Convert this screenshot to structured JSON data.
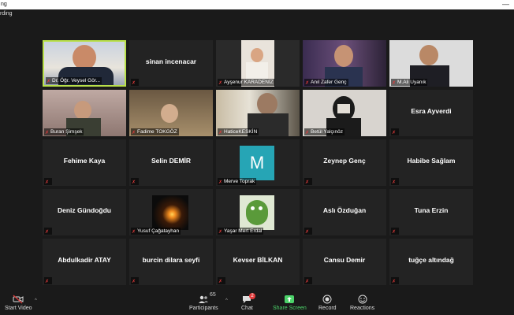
{
  "window": {
    "title": "ng",
    "minimize_glyph": "—"
  },
  "recording_label": "rding",
  "tiles": [
    {
      "name": "Dr. Öğr. Veysel Gör...",
      "kind": "video"
    },
    {
      "name": "sinan incenacar",
      "kind": "name"
    },
    {
      "name": "Ayşenur KARADENİZ",
      "kind": "video"
    },
    {
      "name": "Anıl Zafer Genç",
      "kind": "video"
    },
    {
      "name": "M.Ali Uyanık",
      "kind": "video"
    },
    {
      "name": "Buran Şimşek",
      "kind": "video"
    },
    {
      "name": "Fadime TOKGÖZ",
      "kind": "video"
    },
    {
      "name": "HaticeKESKİN",
      "kind": "video"
    },
    {
      "name": "Betül Yalçınöz",
      "kind": "video"
    },
    {
      "name": "Esra Ayverdi",
      "kind": "name"
    },
    {
      "name": "Fehime Kaya",
      "kind": "name"
    },
    {
      "name": "Selin DEMİR",
      "kind": "name"
    },
    {
      "name": "Merve Toprak",
      "kind": "avatar",
      "initial": "M"
    },
    {
      "name": "Zeynep Genç",
      "kind": "name"
    },
    {
      "name": "Habibe Sağlam",
      "kind": "name"
    },
    {
      "name": "Deniz Gündoğdu",
      "kind": "name"
    },
    {
      "name": "Yusuf Çağatayhan",
      "kind": "image"
    },
    {
      "name": "Yaşar Mert Erdal",
      "kind": "image"
    },
    {
      "name": "Aslı Özduğan",
      "kind": "name"
    },
    {
      "name": "Tuna Erzin",
      "kind": "name"
    },
    {
      "name": "Abdulkadir ATAY",
      "kind": "name"
    },
    {
      "name": "burcin dilara seyfi",
      "kind": "name"
    },
    {
      "name": "Kevser BİLKAN",
      "kind": "name"
    },
    {
      "name": "Cansu Demir",
      "kind": "name"
    },
    {
      "name": "tuğçe altındağ",
      "kind": "name"
    }
  ],
  "toolbar": {
    "start_video": "Start Video",
    "participants": "Participants",
    "participants_count": "65",
    "chat": "Chat",
    "chat_badge": "2",
    "share_screen": "Share Screen",
    "record": "Record",
    "reactions": "Reactions",
    "caret": "^"
  },
  "colors": {
    "accent_green": "#4cd36a",
    "active_speaker": "#b9e04a",
    "mute_red": "#e23b3b",
    "avatar_teal": "#26a5b5"
  }
}
